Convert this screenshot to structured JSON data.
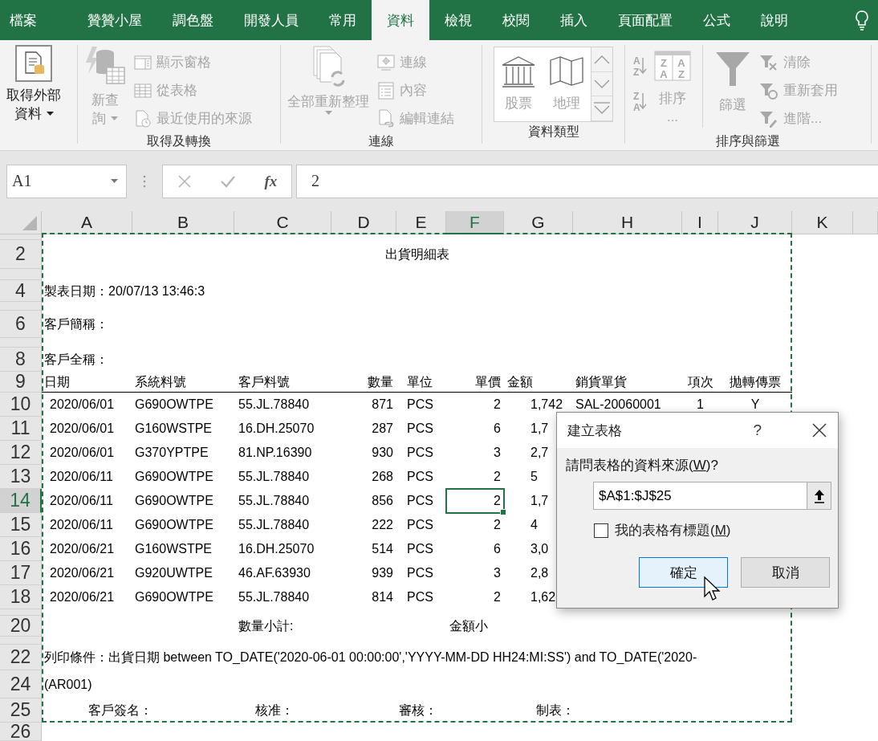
{
  "ribbon_tabs": [
    {
      "label": "檔案",
      "selected": false
    },
    {
      "label": "贊贊小屋",
      "selected": false
    },
    {
      "label": "調色盤",
      "selected": false
    },
    {
      "label": "開發人員",
      "selected": false
    },
    {
      "label": "常用",
      "selected": false
    },
    {
      "label": "資料",
      "selected": true
    },
    {
      "label": "檢視",
      "selected": false
    },
    {
      "label": "校閱",
      "selected": false
    },
    {
      "label": "插入",
      "selected": false
    },
    {
      "label": "頁面配置",
      "selected": false
    },
    {
      "label": "公式",
      "selected": false
    },
    {
      "label": "說明",
      "selected": false
    }
  ],
  "ribbon_groups": [
    {
      "items": [
        {
          "kind": "large",
          "lines": [
            "取得外部",
            "資料"
          ],
          "dropdown": true,
          "disabled": false
        }
      ]
    },
    {
      "label": "取得及轉換",
      "items": [
        {
          "kind": "large",
          "lines": [
            "新查",
            "詢"
          ],
          "dropdown": true,
          "disabled": true
        },
        {
          "kind": "stack",
          "items": [
            {
              "label": "顯示窗格",
              "disabled": true
            },
            {
              "label": "從表格",
              "disabled": true
            },
            {
              "label": "最近使用的來源",
              "disabled": true
            }
          ]
        }
      ]
    },
    {
      "label": "連線",
      "items": [
        {
          "kind": "large",
          "lines": [
            "全部重新整理"
          ],
          "dropdown": true,
          "disabled": true
        },
        {
          "kind": "stack",
          "items": [
            {
              "label": "連線",
              "disabled": true
            },
            {
              "label": "內容",
              "disabled": true
            },
            {
              "label": "編輯連結",
              "disabled": true
            }
          ]
        }
      ]
    },
    {
      "label": "資料類型",
      "items": [
        {
          "kind": "gallery",
          "items": [
            {
              "label": "股票",
              "disabled": true
            },
            {
              "label": "地理",
              "disabled": true
            }
          ]
        }
      ]
    },
    {
      "label": "排序與篩選",
      "items": [
        {
          "kind": "icon-stack",
          "items": [
            {
              "glyphs": [
                "A",
                "Z"
              ],
              "disabled": true
            },
            {
              "glyphs": [
                "Z",
                "A"
              ],
              "disabled": true
            }
          ]
        },
        {
          "kind": "large",
          "lines": [
            "排序",
            "..."
          ],
          "glyphs": [
            "Z",
            "A",
            "A",
            "Z"
          ],
          "disabled": true
        },
        {
          "kind": "separator"
        },
        {
          "kind": "large",
          "lines": [
            "篩選"
          ],
          "disabled": true
        },
        {
          "kind": "stack",
          "items": [
            {
              "label": "清除",
              "disabled": true
            },
            {
              "label": "重新套用",
              "disabled": true
            },
            {
              "label": "進階...",
              "disabled": true
            }
          ]
        }
      ]
    }
  ],
  "formula_bar": {
    "name_box": "A1",
    "function_symbol": "fx",
    "formula": "2"
  },
  "sheet": {
    "copy_marquee": true,
    "columns": [
      {
        "label": "A",
        "selected": false
      },
      {
        "label": "B",
        "selected": false
      },
      {
        "label": "C",
        "selected": false
      },
      {
        "label": "D",
        "selected": false
      },
      {
        "label": "E",
        "selected": false
      },
      {
        "label": "F",
        "selected": true
      },
      {
        "label": "G",
        "selected": false
      },
      {
        "label": "H",
        "selected": false
      },
      {
        "label": "I",
        "selected": false
      },
      {
        "label": "J",
        "selected": false
      },
      {
        "label": "K",
        "selected": false
      }
    ],
    "rows": [
      {
        "selected": false,
        "kind": "text",
        "cells": []
      },
      {
        "label": "2",
        "selected": false,
        "kind": "title",
        "cells": [
          "出貨明細表"
        ]
      },
      {
        "selected": false,
        "kind": "text",
        "cells": []
      },
      {
        "label": "4",
        "selected": false,
        "kind": "text",
        "cells": [
          "製表日期：20/07/13 13:46:3"
        ]
      },
      {
        "selected": false,
        "kind": "text",
        "cells": []
      },
      {
        "label": "6",
        "selected": false,
        "kind": "text",
        "cells": [
          "客戶簡稱："
        ]
      },
      {
        "selected": false,
        "kind": "text",
        "cells": []
      },
      {
        "label": "8",
        "selected": false,
        "kind": "text",
        "cells": [
          "客戶全稱："
        ]
      },
      {
        "label": "9",
        "selected": false,
        "kind": "header",
        "cells": [
          "日期",
          "系統料號",
          "客戶料號",
          "數量",
          "單位",
          "單價",
          "金額",
          "銷貨單貨",
          "項次",
          "拋轉傳票"
        ]
      },
      {
        "label": "10",
        "selected": false,
        "kind": "data",
        "cells": [
          "2020/06/01",
          "G690OWTPE",
          "55.JL.78840",
          "871",
          "PCS",
          "2",
          "1,742",
          "SAL-20060001",
          "1",
          "Y"
        ]
      },
      {
        "label": "11",
        "selected": false,
        "kind": "data",
        "cells": [
          "2020/06/01",
          "G160WSTPE",
          "16.DH.25070",
          "287",
          "PCS",
          "6",
          "1,7"
        ]
      },
      {
        "label": "12",
        "selected": false,
        "kind": "data",
        "cells": [
          "2020/06/01",
          "G370YPTPE",
          "81.NP.16390",
          "930",
          "PCS",
          "3",
          "2,7"
        ]
      },
      {
        "label": "13",
        "selected": false,
        "kind": "data",
        "cells": [
          "2020/06/11",
          "G690OWTPE",
          "55.JL.78840",
          "268",
          "PCS",
          "2",
          "5"
        ]
      },
      {
        "label": "14",
        "selected": true,
        "kind": "data",
        "cells": [
          "2020/06/11",
          "G690OWTPE",
          "55.JL.78840",
          "856",
          "PCS",
          "2",
          "1,7"
        ]
      },
      {
        "label": "15",
        "selected": false,
        "kind": "data",
        "cells": [
          "2020/06/11",
          "G690OWTPE",
          "55.JL.78840",
          "222",
          "PCS",
          "2",
          "4"
        ]
      },
      {
        "label": "16",
        "selected": false,
        "kind": "data",
        "cells": [
          "2020/06/21",
          "G160WSTPE",
          "16.DH.25070",
          "514",
          "PCS",
          "6",
          "3,0"
        ]
      },
      {
        "label": "17",
        "selected": false,
        "kind": "data",
        "cells": [
          "2020/06/21",
          "G920UWTPE",
          "46.AF.63930",
          "939",
          "PCS",
          "3",
          "2,8"
        ]
      },
      {
        "label": "18",
        "selected": false,
        "kind": "data",
        "cells": [
          "2020/06/21",
          "G690OWTPE",
          "55.JL.78840",
          "814",
          "PCS",
          "2",
          "1,62"
        ]
      },
      {
        "selected": false,
        "kind": "text",
        "cells": []
      },
      {
        "label": "20",
        "selected": false,
        "kind": "subtotal",
        "cells": [
          "",
          "",
          "數量小計:",
          "",
          "",
          "金額小"
        ]
      },
      {
        "selected": false,
        "kind": "text",
        "cells": []
      },
      {
        "label": "22",
        "selected": false,
        "kind": "text",
        "cells": [
          "列印條件：出貨日期 between TO_DATE('2020-06-01 00:00:00','YYYY-MM-DD HH24:MI:SS') and TO_DATE('2020-"
        ]
      },
      {
        "label": "24",
        "selected": false,
        "kind": "text",
        "cells": [
          "(AR001)"
        ]
      },
      {
        "label": "25",
        "selected": false,
        "kind": "signature",
        "cells": [
          "客戶簽名：",
          "",
          "核准：",
          "",
          "審核：",
          "",
          "制表："
        ]
      },
      {
        "label": "26",
        "selected": false,
        "kind": "text",
        "cells": []
      }
    ]
  },
  "dialog": {
    "title": "建立表格",
    "help": "?",
    "prompt_parts": [
      "請問表格的資料來源(",
      "W",
      ")?"
    ],
    "range_value": "$A$1:$J$25",
    "checkbox": {
      "label_parts": [
        "我的表格有標題(",
        "M",
        ")"
      ],
      "checked": false
    },
    "buttons": [
      {
        "label": "確定",
        "kind": "default"
      },
      {
        "label": "取消",
        "kind": "normal"
      }
    ]
  }
}
